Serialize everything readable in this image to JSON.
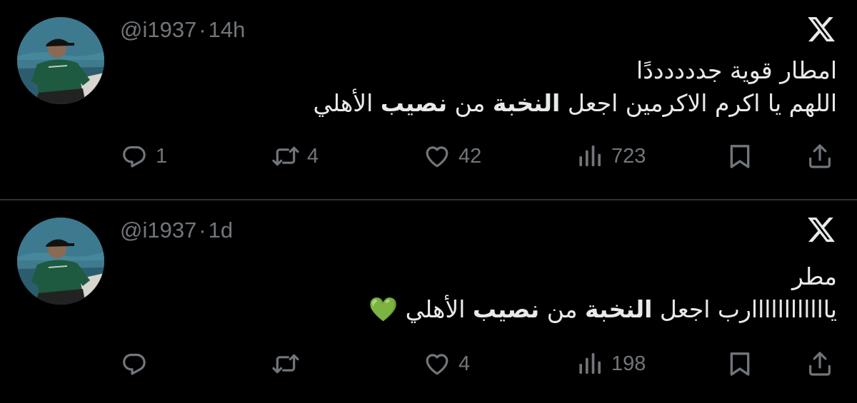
{
  "tweets": [
    {
      "handle": "@i1937",
      "separator": "·",
      "time": "14h",
      "lines": [
        [
          {
            "t": "امطار قوية جددددددًا",
            "b": false
          }
        ],
        [
          {
            "t": "اللهم يا اكرم الاكرمين اجعل ",
            "b": false
          },
          {
            "t": "النخبة",
            "b": true
          },
          {
            "t": " من ",
            "b": false
          },
          {
            "t": "نصيب",
            "b": true
          },
          {
            "t": " الأهلي",
            "b": false
          }
        ]
      ],
      "reply_count": "1",
      "retweet_count": "4",
      "like_count": "42",
      "view_count": "723"
    },
    {
      "handle": "@i1937",
      "separator": "·",
      "time": "1d",
      "lines": [
        [
          {
            "t": "مطر",
            "b": false
          }
        ],
        [
          {
            "t": "ياااااااااااارب اجعل ",
            "b": false
          },
          {
            "t": "النخبة",
            "b": true
          },
          {
            "t": " من ",
            "b": false
          },
          {
            "t": "نصيب",
            "b": true
          },
          {
            "t": " الأهلي 💚",
            "b": false
          }
        ]
      ],
      "reply_count": "",
      "retweet_count": "",
      "like_count": "4",
      "view_count": "198"
    }
  ],
  "icons": {
    "platform": "x-logo-icon",
    "reply": "reply-icon",
    "retweet": "retweet-icon",
    "like": "heart-icon",
    "views": "views-icon",
    "bookmark": "bookmark-icon",
    "share": "share-icon"
  },
  "colors": {
    "background": "#000000",
    "text": "#e7e9ea",
    "muted": "#71767b",
    "divider": "#2f3336",
    "heart_emoji": "#43c646"
  }
}
